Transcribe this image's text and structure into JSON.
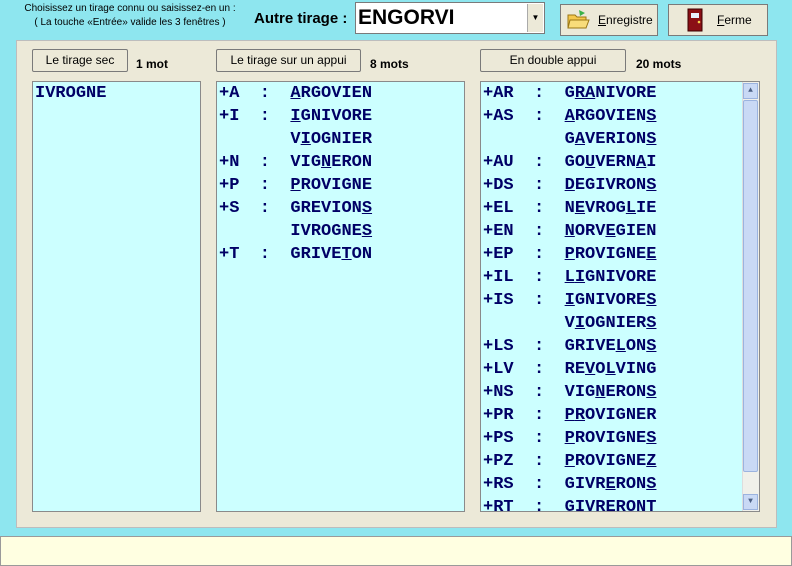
{
  "header": {
    "instruction_line1": "Choisissez un tirage connu ou saisissez-en un :",
    "instruction_line2": "( La touche «Entrée» valide les 3 fenêtres )",
    "autre_label": "Autre tirage :",
    "tirage_value": "ENGORVI"
  },
  "toolbar": {
    "save_prefix": "E",
    "save_rest": "nregistre",
    "close_prefix": "F",
    "close_rest": "erme"
  },
  "panes": {
    "sec": {
      "button": "Le tirage sec",
      "count": "1 mot",
      "rows": [
        {
          "prefix": "",
          "letters": "IVROGNE",
          "underline": []
        }
      ]
    },
    "appui": {
      "button": "Le tirage sur un appui",
      "count": "8 mots",
      "rows": [
        {
          "prefix": "+A  :  ",
          "letters": "ARGOVIEN",
          "underline": [
            0
          ]
        },
        {
          "prefix": "+I  :  ",
          "letters": "IGNIVORE",
          "underline": [
            0
          ]
        },
        {
          "prefix": "       ",
          "letters": "VIOGNIER",
          "underline": [
            1
          ]
        },
        {
          "prefix": "+N  :  ",
          "letters": "VIGNERON",
          "underline": [
            3
          ]
        },
        {
          "prefix": "+P  :  ",
          "letters": "PROVIGNE",
          "underline": [
            0
          ]
        },
        {
          "prefix": "+S  :  ",
          "letters": "GREVIONS",
          "underline": [
            7
          ]
        },
        {
          "prefix": "       ",
          "letters": "IVROGNES",
          "underline": [
            7
          ]
        },
        {
          "prefix": "+T  :  ",
          "letters": "GRIVETON",
          "underline": [
            5
          ]
        }
      ]
    },
    "double": {
      "button": "En double appui",
      "count": "20 mots",
      "rows": [
        {
          "prefix": "+AR  :  ",
          "letters": "GRANIVORE",
          "underline": [
            1,
            2
          ]
        },
        {
          "prefix": "+AS  :  ",
          "letters": "ARGOVIENS",
          "underline": [
            0,
            8
          ]
        },
        {
          "prefix": "        ",
          "letters": "GAVERIONS",
          "underline": [
            1,
            8
          ]
        },
        {
          "prefix": "+AU  :  ",
          "letters": "GOUVERNAI",
          "underline": [
            2,
            7
          ]
        },
        {
          "prefix": "+DS  :  ",
          "letters": "DEGIVRONS",
          "underline": [
            0,
            8
          ]
        },
        {
          "prefix": "+EL  :  ",
          "letters": "NEVROGLIE",
          "underline": [
            1,
            6
          ]
        },
        {
          "prefix": "+EN  :  ",
          "letters": "NORVEGIEN",
          "underline": [
            0,
            4
          ]
        },
        {
          "prefix": "+EP  :  ",
          "letters": "PROVIGNEE",
          "underline": [
            0,
            8
          ]
        },
        {
          "prefix": "+IL  :  ",
          "letters": "LIGNIVORE",
          "underline": [
            0,
            1
          ]
        },
        {
          "prefix": "+IS  :  ",
          "letters": "IGNIVORES",
          "underline": [
            0,
            8
          ]
        },
        {
          "prefix": "        ",
          "letters": "VIOGNIERS",
          "underline": [
            1,
            8
          ]
        },
        {
          "prefix": "+LS  :  ",
          "letters": "GRIVELONS",
          "underline": [
            5,
            8
          ]
        },
        {
          "prefix": "+LV  :  ",
          "letters": "REVOLVING",
          "underline": [
            2,
            4
          ]
        },
        {
          "prefix": "+NS  :  ",
          "letters": "VIGNERONS",
          "underline": [
            3,
            8
          ]
        },
        {
          "prefix": "+PR  :  ",
          "letters": "PROVIGNER",
          "underline": [
            0,
            1
          ]
        },
        {
          "prefix": "+PS  :  ",
          "letters": "PROVIGNES",
          "underline": [
            0,
            8
          ]
        },
        {
          "prefix": "+PZ  :  ",
          "letters": "PROVIGNEZ",
          "underline": [
            0,
            8
          ]
        },
        {
          "prefix": "+RS  :  ",
          "letters": "GIVRERONS",
          "underline": [
            4,
            8
          ]
        },
        {
          "prefix": "+RT  :  ",
          "letters": "GIVRERONT",
          "underline": [
            4,
            8
          ]
        }
      ]
    }
  },
  "scrollbar": {
    "up": "▲",
    "down": "▼"
  },
  "colors": {
    "background": "#8ee6ef",
    "list_bg": "#ccffff",
    "text": "#000066",
    "status_bg": "#ffffe1"
  },
  "status": {
    "text": ""
  }
}
